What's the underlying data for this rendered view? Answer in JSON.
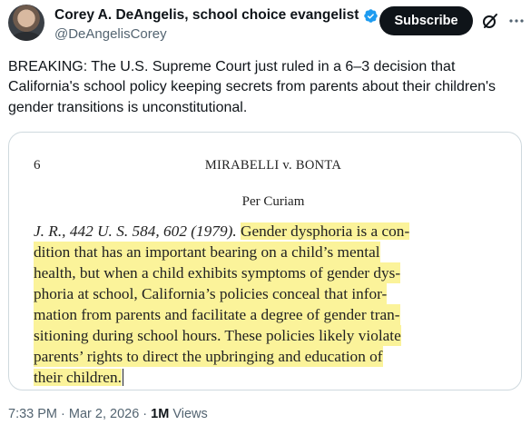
{
  "author": {
    "display_name": "Corey A. DeAngelis, school choice evangelist",
    "handle": "@DeAngelisCorey"
  },
  "actions": {
    "subscribe_label": "Subscribe",
    "grok_icon": "grok-slash-icon",
    "more_icon": "more-icon"
  },
  "tweet": {
    "text": "BREAKING: The U.S. Supreme Court just ruled in a 6–3 decision that California's school policy keeping secrets from parents about their children's gender transitions is unconstitutional."
  },
  "document": {
    "page_number": "6",
    "case_title": "MIRABELLI v. BONTA",
    "section": "Per Curiam",
    "citation": "J. R., 442 U. S. 584, 602 (1979).",
    "lines": [
      "Gender dysphoria is a con-",
      "dition that has an important bearing on a child’s mental",
      "health, but when a child exhibits symptoms of gender dys-",
      "phoria at school, California’s policies conceal that infor-",
      "mation from parents and facilitate a degree of gender tran-",
      "sitioning during school hours.  These policies likely violate",
      "parents’ rights to direct the upbringing and education of",
      "their children."
    ],
    "highlight_color": "#fbf39a"
  },
  "meta": {
    "time": "7:33 PM",
    "separator1": " · ",
    "date": "Mar 2, 2026",
    "separator2": " · ",
    "views_count": "1M",
    "views_label": " Views"
  },
  "colors": {
    "text": "#0f1419",
    "secondary": "#536471",
    "verified": "#1d9bf0",
    "button_bg": "#0f1419",
    "border": "#cfd9de"
  }
}
